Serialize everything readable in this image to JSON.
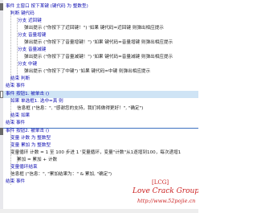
{
  "editor": {
    "lines": [
      "事件 主窗口 按下某键 (键代码 为 整数型)",
      "判断 键代码",
      "分支 近回键",
      "弹出提示 (\"你按下了近回键！\") '如果 键代码=近回键 则弹出相应提示",
      "分支 音量增键",
      "弹出提示 (\"你按下了音量增键！\") '如果 键代码=音量增键 则弹出相应提示",
      "分支 音量减键",
      "弹出提示 (\"你按下了音量减键！\") '如果 键代码=音量减键 则弹出相应提示",
      "分支 中键",
      "弹出提示 (\"你按下了中键\") '如果 键代码=中键 则弹出相应提示",
      "结束 判断",
      "结束 事件",
      "事件 按钮1. 被单击 ()",
      "如果 单选框1. 选中=真 则",
      "信息框 (\"信息：\", \"感谢您的支持，我们将做得更好！\", \"确定\")",
      "结束 如果",
      "结束 事件",
      "事件 按钮2. 被单击 ()",
      "变量 计数 为 整数型",
      "变量 累加 为 整数型",
      "变量循环 计数 = 1 至 100 步进 1 '变量循环，变量\"计数\"从1逐增到100，每次递增1",
      "累加 = 累加 + 计数",
      "变量循环结束",
      "信息框 (\"信息：\", \"累加结果为：\" & 累加, \"确定\")",
      "结束 事件"
    ]
  },
  "watermark": {
    "tag": "[LCG]",
    "name": "Love Crack Group",
    "url": "http://www.52pojie.cn"
  },
  "colors": {
    "keyword": "#0b0bb0",
    "comment": "#008000",
    "string": "#8b0000",
    "highlight": "#cfe4f5",
    "watermark": "#cc2222"
  }
}
